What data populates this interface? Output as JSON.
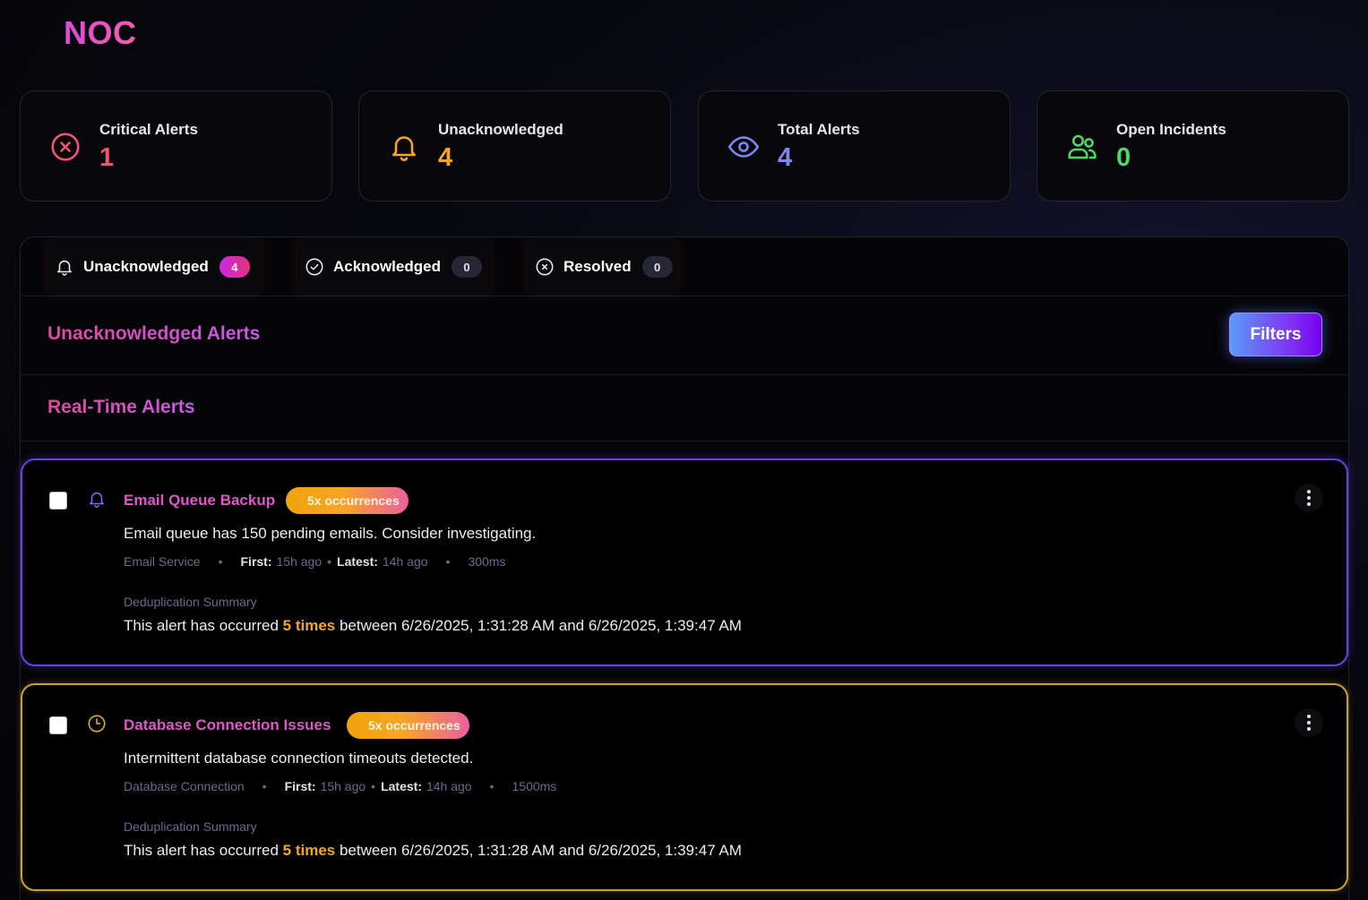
{
  "app": {
    "title": "NOC"
  },
  "stats": [
    {
      "label": "Critical Alerts",
      "value": "1",
      "icon": "x-circle-icon",
      "color": "#f2556f"
    },
    {
      "label": "Unacknowledged",
      "value": "4",
      "icon": "bell-icon",
      "color": "#f5a623"
    },
    {
      "label": "Total Alerts",
      "value": "4",
      "icon": "eye-icon",
      "color": "#7f87f5"
    },
    {
      "label": "Open Incidents",
      "value": "0",
      "icon": "users-icon",
      "color": "#4cd964"
    }
  ],
  "tabs": [
    {
      "label": "Unacknowledged",
      "count": "4",
      "icon": "bell-icon"
    },
    {
      "label": "Acknowledged",
      "count": "0",
      "icon": "check-circle-icon"
    },
    {
      "label": "Resolved",
      "count": "0",
      "icon": "x-circle-icon"
    }
  ],
  "section": {
    "title": "Unacknowledged Alerts",
    "filters_label": "Filters"
  },
  "realtime": {
    "title": "Real-Time Alerts"
  },
  "alerts": [
    {
      "title": "Email Queue Backup",
      "occurrences": "5x occurrences",
      "description": "Email queue has 150 pending emails. Consider investigating.",
      "service": "Email Service",
      "first_label": "First:",
      "first": "15h ago",
      "latest_label": "Latest:",
      "latest": "14h ago",
      "duration": "300ms",
      "dedup_label": "Deduplication Summary",
      "dedup_prefix": "This alert has occurred",
      "dedup_times": "5 times",
      "dedup_suffix": "between 6/26/2025, 1:31:28 AM and 6/26/2025, 1:39:47 AM",
      "icon": "bell-icon",
      "border_color": "#6b3ee6"
    },
    {
      "title": "Database Connection Issues",
      "occurrences": "5x occurrences",
      "description": "Intermittent database connection timeouts detected.",
      "service": "Database Connection",
      "first_label": "First:",
      "first": "15h ago",
      "latest_label": "Latest:",
      "latest": "14h ago",
      "duration": "1500ms",
      "dedup_label": "Deduplication Summary",
      "dedup_prefix": "This alert has occurred",
      "dedup_times": "5 times",
      "dedup_suffix": "between 6/26/2025, 1:31:28 AM and 6/26/2025, 1:39:47 AM",
      "icon": "clock-icon",
      "border_color": "#c9a226"
    }
  ]
}
